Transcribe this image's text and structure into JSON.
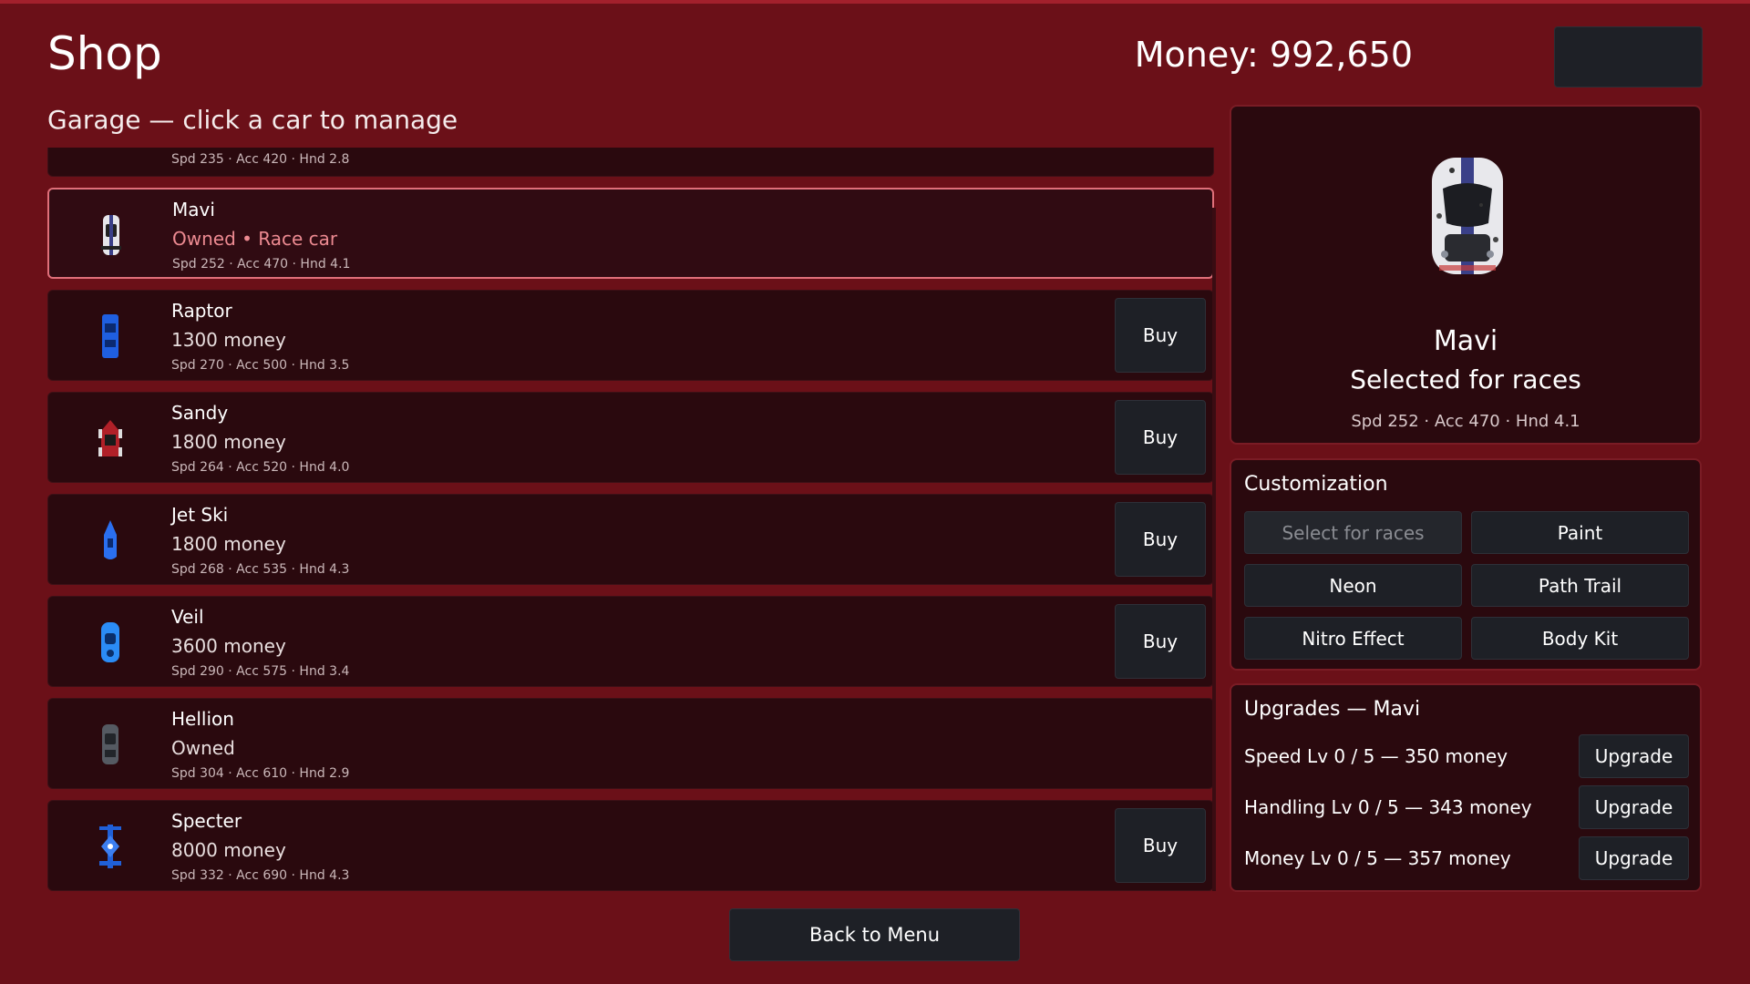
{
  "header": {
    "title": "Shop",
    "money": "Money: 992,650",
    "subtitle": "Garage — click a car to manage"
  },
  "garage": {
    "cars": [
      {
        "name": "",
        "price": "",
        "stats": "Spd 235 · Acc 420 · Hnd 2.8",
        "icon": "red-car-icon",
        "color": "#c8202a"
      },
      {
        "name": "Mavi",
        "price": "Owned  •  Race car",
        "stats": "Spd 252 · Acc 470 · Hnd 4.1",
        "icon": "white-car-icon",
        "color": "#e6e6ea",
        "selected": true
      },
      {
        "name": "Raptor",
        "price": "1300 money",
        "stats": "Spd 270 · Acc 500 · Hnd 3.5",
        "icon": "blue-car-icon",
        "color": "#1f5fe0",
        "buy": "Buy"
      },
      {
        "name": "Sandy",
        "price": "1800 money",
        "stats": "Spd 264 · Acc 520 · Hnd 4.0",
        "icon": "buggy-car-icon",
        "color": "#b02028",
        "buy": "Buy"
      },
      {
        "name": "Jet Ski",
        "price": "1800 money",
        "stats": "Spd 268 · Acc 535 · Hnd 4.3",
        "icon": "jet-ski-icon",
        "color": "#2a6ff0",
        "buy": "Buy"
      },
      {
        "name": "Veil",
        "price": "3600 money",
        "stats": "Spd 290 · Acc 575 · Hnd 3.4",
        "icon": "blue-sports-car-icon",
        "color": "#2b8cf5",
        "buy": "Buy"
      },
      {
        "name": "Hellion",
        "price": "Owned",
        "stats": "Spd 304 · Acc 610 · Hnd 2.9",
        "icon": "dark-car-icon",
        "color": "#555a62"
      },
      {
        "name": "Specter",
        "price": "8000 money",
        "stats": "Spd 332 · Acc 690 · Hnd 4.3",
        "icon": "formula-car-icon",
        "color": "#2060d8",
        "buy": "Buy"
      }
    ]
  },
  "preview": {
    "name": "Mavi",
    "status": "Selected for races",
    "stats": "Spd 252 · Acc 470 · Hnd 4.1"
  },
  "customization": {
    "title": "Customization",
    "buttons": [
      "Select for races",
      "Paint",
      "Neon",
      "Path Trail",
      "Nitro Effect",
      "Body Kit"
    ]
  },
  "upgrades": {
    "title": "Upgrades — Mavi",
    "rows": [
      {
        "label": "Speed  Lv 0 / 5  —  350 money",
        "button": "Upgrade"
      },
      {
        "label": "Handling  Lv 0 / 5  —  343 money",
        "button": "Upgrade"
      },
      {
        "label": "Money  Lv 0 / 5  —  357 money",
        "button": "Upgrade"
      }
    ]
  },
  "footer": {
    "back": "Back to Menu"
  }
}
